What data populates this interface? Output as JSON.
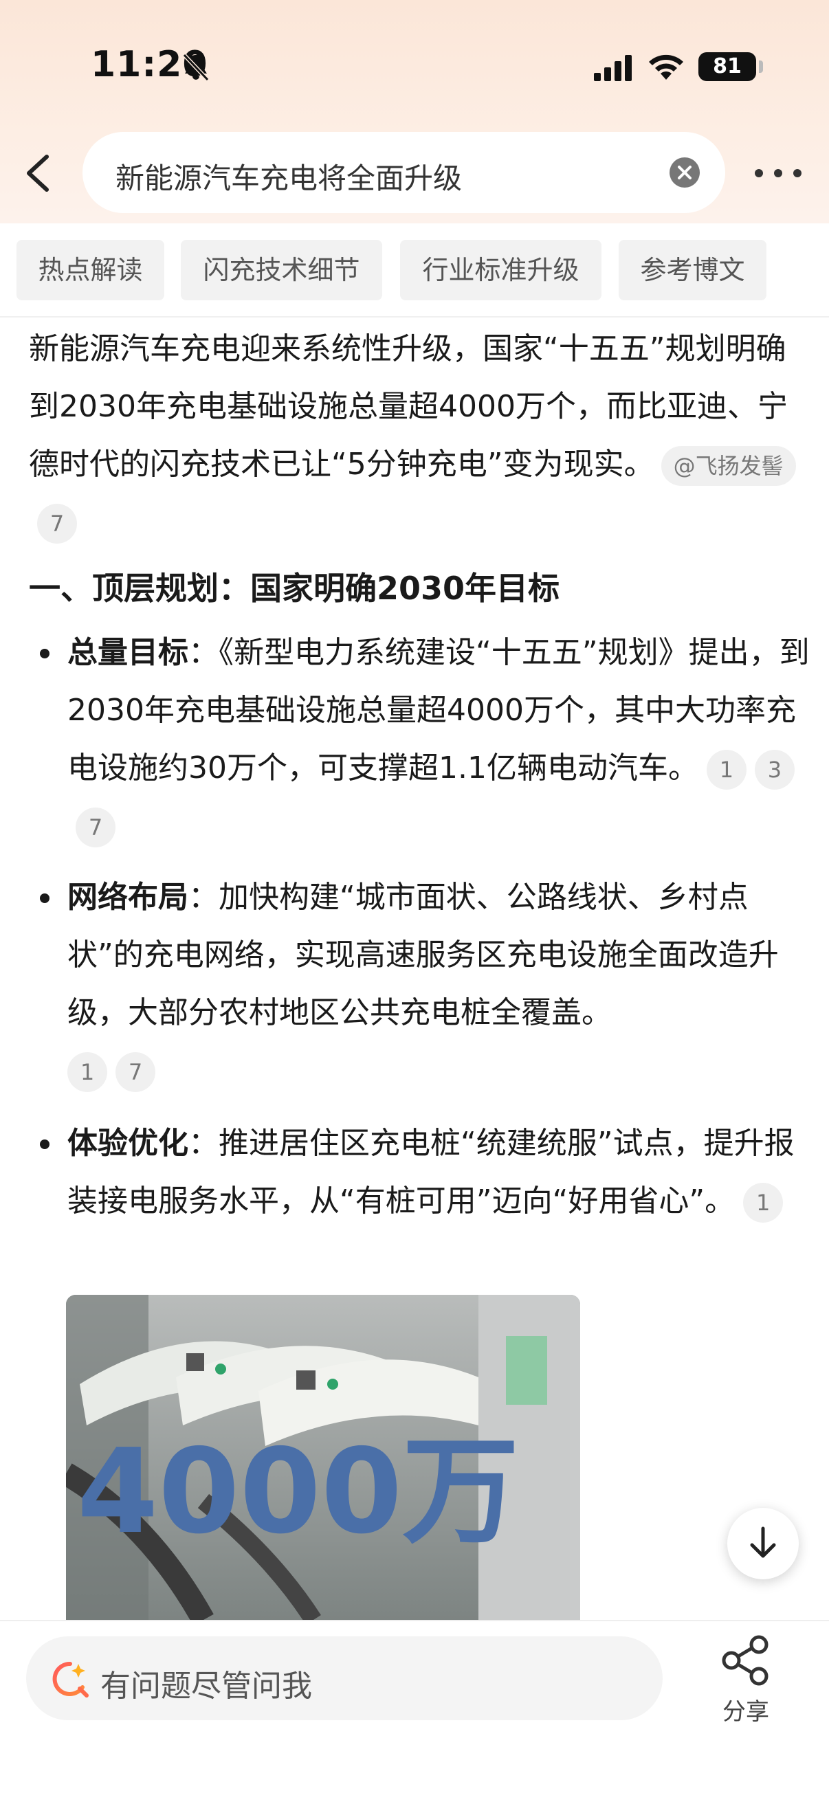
{
  "status_bar": {
    "time": "11:20",
    "battery": "81"
  },
  "header": {
    "search_query": "新能源汽车充电将全面升级"
  },
  "tabs": [
    {
      "label": "热点解读"
    },
    {
      "label": "闪充技术细节"
    },
    {
      "label": "行业标准升级"
    },
    {
      "label": "参考博文"
    }
  ],
  "article": {
    "intro": "新能源汽车充电迎来系统性升级，国家“十五五”规划明确到2030年充电基础设施总量超4000万个，而比亚迪、宁德时代的闪充技术已让“5分钟充电”变为现实。",
    "intro_source": "@飞扬发髻",
    "intro_cite": "7",
    "section_heading": "一、顶层规划：国家明确2030年目标",
    "bullets": [
      {
        "title": "总量目标",
        "text": "：《新型电力系统建设“十五五”规划》提出，到2030年充电基础设施总量超4000万个，其中大功率充电设施约30万个，可支撑超1.1亿辆电动汽车。",
        "cites": [
          "1",
          "3",
          "7"
        ]
      },
      {
        "title": "网络布局",
        "text": "：加快构建“城市面状、公路线状、乡村点状”的充电网络，实现高速服务区充电设施全面改造升级，大部分农村地区公共充电桩全覆盖。",
        "cites": [
          "1",
          "7"
        ]
      },
      {
        "title": "体验优化",
        "text": "：推进居住区充电桩“统建统服”试点，提升报装接电服务水平，从“有桩可用”迈向“好用省心”。",
        "cites": [
          "1"
        ]
      }
    ],
    "image_caption": "4000万"
  },
  "bottom_bar": {
    "ask_placeholder": "有问题尽管问我",
    "share_label": "分享"
  }
}
